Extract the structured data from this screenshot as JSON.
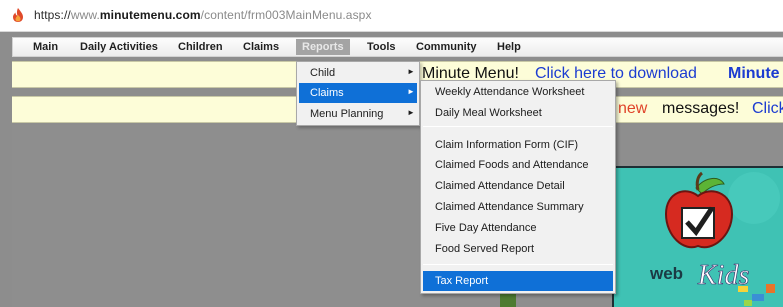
{
  "browser": {
    "url_scheme": "https://",
    "url_prefix": "www.",
    "url_host": "minutemenu.com",
    "url_path": "/content/frm003MainMenu.aspx"
  },
  "menubar": {
    "items": [
      {
        "label": "Main"
      },
      {
        "label": "Daily Activities"
      },
      {
        "label": "Children"
      },
      {
        "label": "Claims"
      },
      {
        "label": "Reports"
      },
      {
        "label": "Tools"
      },
      {
        "label": "Community"
      },
      {
        "label": "Help"
      }
    ],
    "active": "Reports"
  },
  "banners": {
    "line1_text": "Minute Menu!",
    "line1_link": "Click here to download",
    "line1_bold": "Minute M",
    "line2_new": "new",
    "line2_text": "messages!",
    "line2_link": "Click"
  },
  "reports_menu": {
    "items": [
      {
        "label": "Child",
        "has_submenu": true
      },
      {
        "label": "Claims",
        "has_submenu": true,
        "selected": true
      },
      {
        "label": "Menu Planning",
        "has_submenu": true
      }
    ]
  },
  "claims_submenu": {
    "items": [
      {
        "label": "Weekly Attendance Worksheet"
      },
      {
        "label": "Daily Meal Worksheet"
      },
      {
        "label": "Claim Information Form (CIF)"
      },
      {
        "label": "Claimed Foods and Attendance"
      },
      {
        "label": "Claimed Attendance Detail"
      },
      {
        "label": "Claimed Attendance Summary"
      },
      {
        "label": "Five Day Attendance"
      },
      {
        "label": "Food Served Report"
      },
      {
        "label": "Tax Report",
        "selected": true
      }
    ]
  },
  "logo": {
    "text_web": "web",
    "text_kids": "Kids"
  },
  "colors": {
    "menu_selected": "#0f70d7",
    "banner_background": "#fdfdd8",
    "link_blue": "#1c3cd1",
    "logo_background": "#3fc2b4"
  }
}
